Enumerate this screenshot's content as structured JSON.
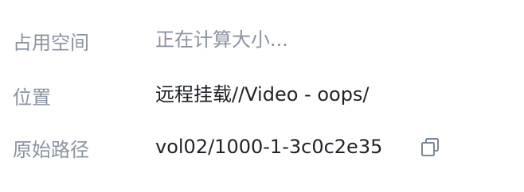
{
  "details": {
    "size": {
      "label": "占用空间",
      "value": "正在计算大小..."
    },
    "location": {
      "label": "位置",
      "value": "远程挂载//Video - oops/"
    },
    "original_path": {
      "label": "原始路径",
      "value": "vol02/1000-1-3c0c2e35",
      "copy_icon": "copy-icon"
    }
  },
  "colors": {
    "label": "#8a93a3",
    "value": "#1f2329",
    "pending": "#8a93a3",
    "icon": "#7d8696"
  }
}
